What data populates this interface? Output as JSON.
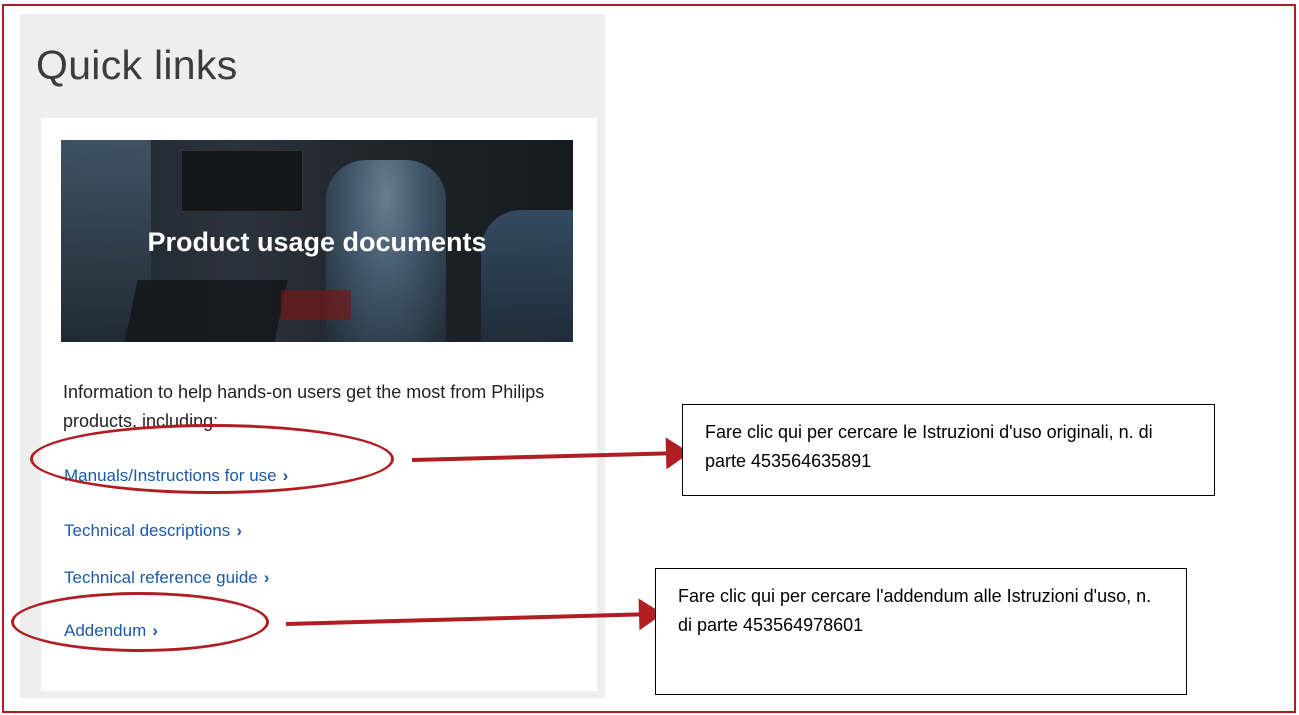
{
  "page": {
    "fragment_label": "• • •"
  },
  "quick_links": {
    "title": "Quick links",
    "card": {
      "hero_title": "Product usage documents",
      "description": "Information to help hands-on users get the most from Philips products, including:",
      "links": [
        {
          "label": "Manuals/Instructions for use",
          "chevron": "›"
        },
        {
          "label": "Technical descriptions",
          "chevron": "›"
        },
        {
          "label": "Technical reference guide",
          "chevron": "›"
        },
        {
          "label": "Addendum",
          "chevron": "›"
        }
      ]
    }
  },
  "annotations": {
    "color": "#b01e23",
    "callout_1": "Fare clic qui per cercare le Istruzioni d'uso originali, n. di parte 453564635891",
    "callout_2": "Fare clic qui per cercare l'addendum alle Istruzioni d'uso, n. di parte 453564978601"
  }
}
